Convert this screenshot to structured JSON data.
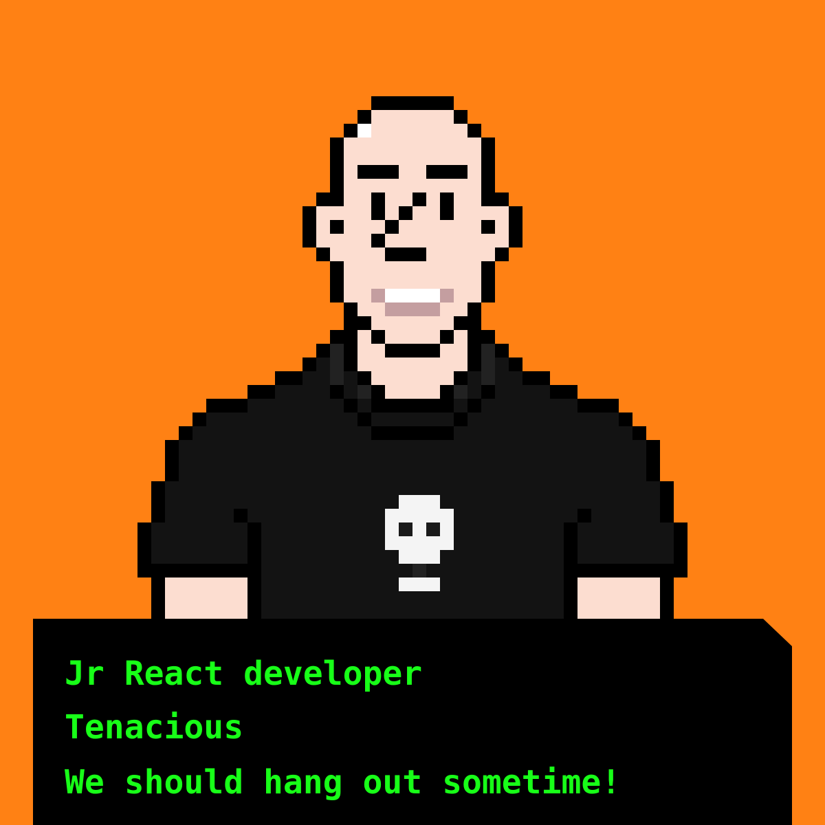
{
  "colors": {
    "background": "#FF8114",
    "outline": "#000000",
    "skin": "#FCDDD0",
    "shirt": "#131313",
    "shirt_shadow": "#222222",
    "highlight": "#FFFFFF",
    "lips": "#C49EA0",
    "teeth": "#FFFFFF",
    "skull": "#F4F4F4",
    "skull_eyes": "#1A1A1A",
    "dialog_bg": "#000000",
    "dialog_text": "#18FF18"
  },
  "character": {
    "head_icon": "bald-head-icon",
    "shirt_icon": "skull-tshirt-icon"
  },
  "dialog": {
    "lines": [
      "Jr React developer",
      "Tenacious",
      "We should hang out sometime!"
    ]
  }
}
